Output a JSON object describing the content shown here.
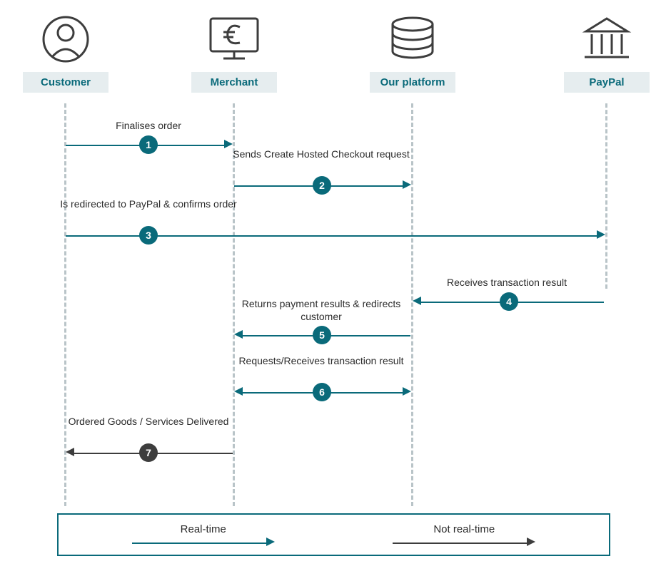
{
  "actors": {
    "customer": "Customer",
    "merchant": "Merchant",
    "platform": "Our platform",
    "paypal": "PayPal"
  },
  "steps": {
    "s1": {
      "num": "1",
      "label": "Finalises order"
    },
    "s2": {
      "num": "2",
      "label": "Sends Create Hosted Checkout request"
    },
    "s3": {
      "num": "3",
      "label": "Is redirected to PayPal & confirms order"
    },
    "s4": {
      "num": "4",
      "label": "Receives transaction result"
    },
    "s5": {
      "num": "5",
      "label": "Returns payment results & redirects customer"
    },
    "s6": {
      "num": "6",
      "label": "Requests/Receives transaction result"
    },
    "s7": {
      "num": "7",
      "label": "Ordered Goods / Services Delivered"
    }
  },
  "legend": {
    "realtime": "Real-time",
    "notrealtime": "Not real-time"
  }
}
